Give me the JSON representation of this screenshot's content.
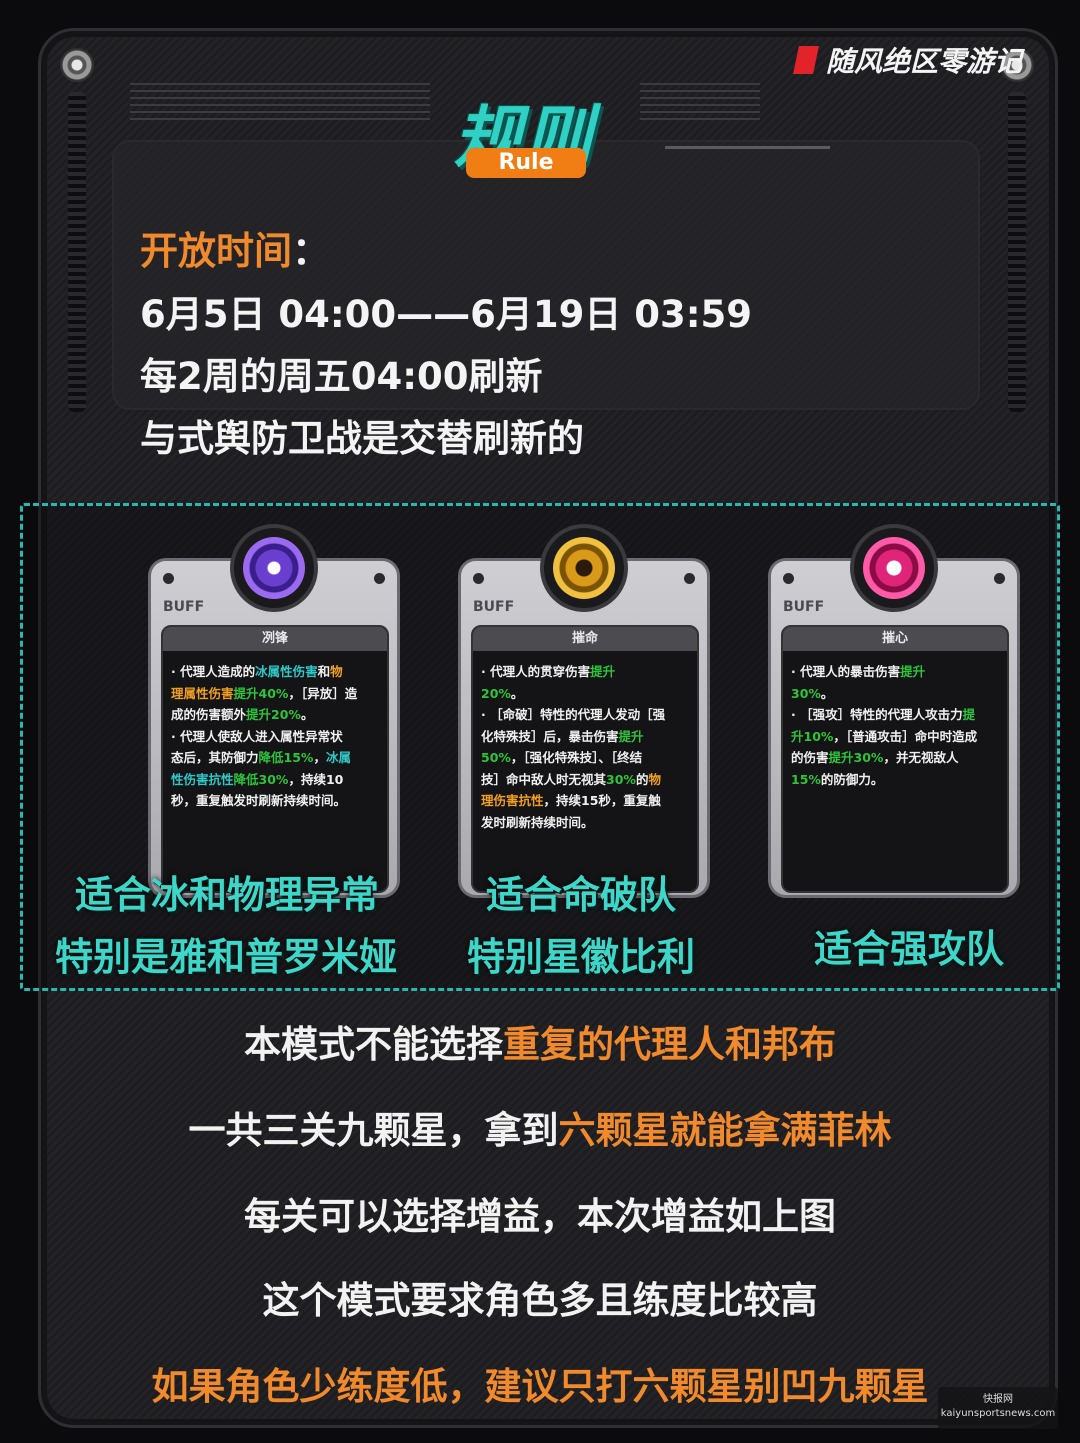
{
  "brand": {
    "name": "随风绝区零游记",
    "flag_color": "#e2242a"
  },
  "title": {
    "main": "规则",
    "sub": "Rule"
  },
  "info": {
    "open_label": "开放时间",
    "open_colon": "：",
    "lines": [
      "6月5日 04:00——6月19日 03:59",
      "每2周的周五04:00刷新",
      "与式舆防卫战是交替刷新的"
    ]
  },
  "cards": [
    {
      "tag": "BUFF",
      "name": "冽锋",
      "emblem_color": "#6a3fd0",
      "caption_lines": [
        "适合冰和物理异常",
        "特别是雅和普罗米娅"
      ]
    },
    {
      "tag": "BUFF",
      "name": "摧命",
      "emblem_color": "#d89a18",
      "caption_lines": [
        "适合命破队",
        "特别星徽比利"
      ]
    },
    {
      "tag": "BUFF",
      "name": "摧心",
      "emblem_color": "#e0247a",
      "caption_lines": [
        "适合强攻队"
      ]
    }
  ],
  "rules": {
    "line1_a": "本模式不能选择",
    "line1_b": "重复的代理人和邦布",
    "line2_a": "一共三关九颗星，拿到",
    "line2_b": "六颗星就能拿满菲林",
    "line3": "每关可以选择增益，本次增益如上图",
    "line4": "这个模式要求角色多且练度比较高",
    "line5": "如果角色少练度低，建议只打六颗星别凹九颗星"
  },
  "watermark": {
    "line1": "快报网",
    "line2": "kaiyunsportsnews.com"
  }
}
